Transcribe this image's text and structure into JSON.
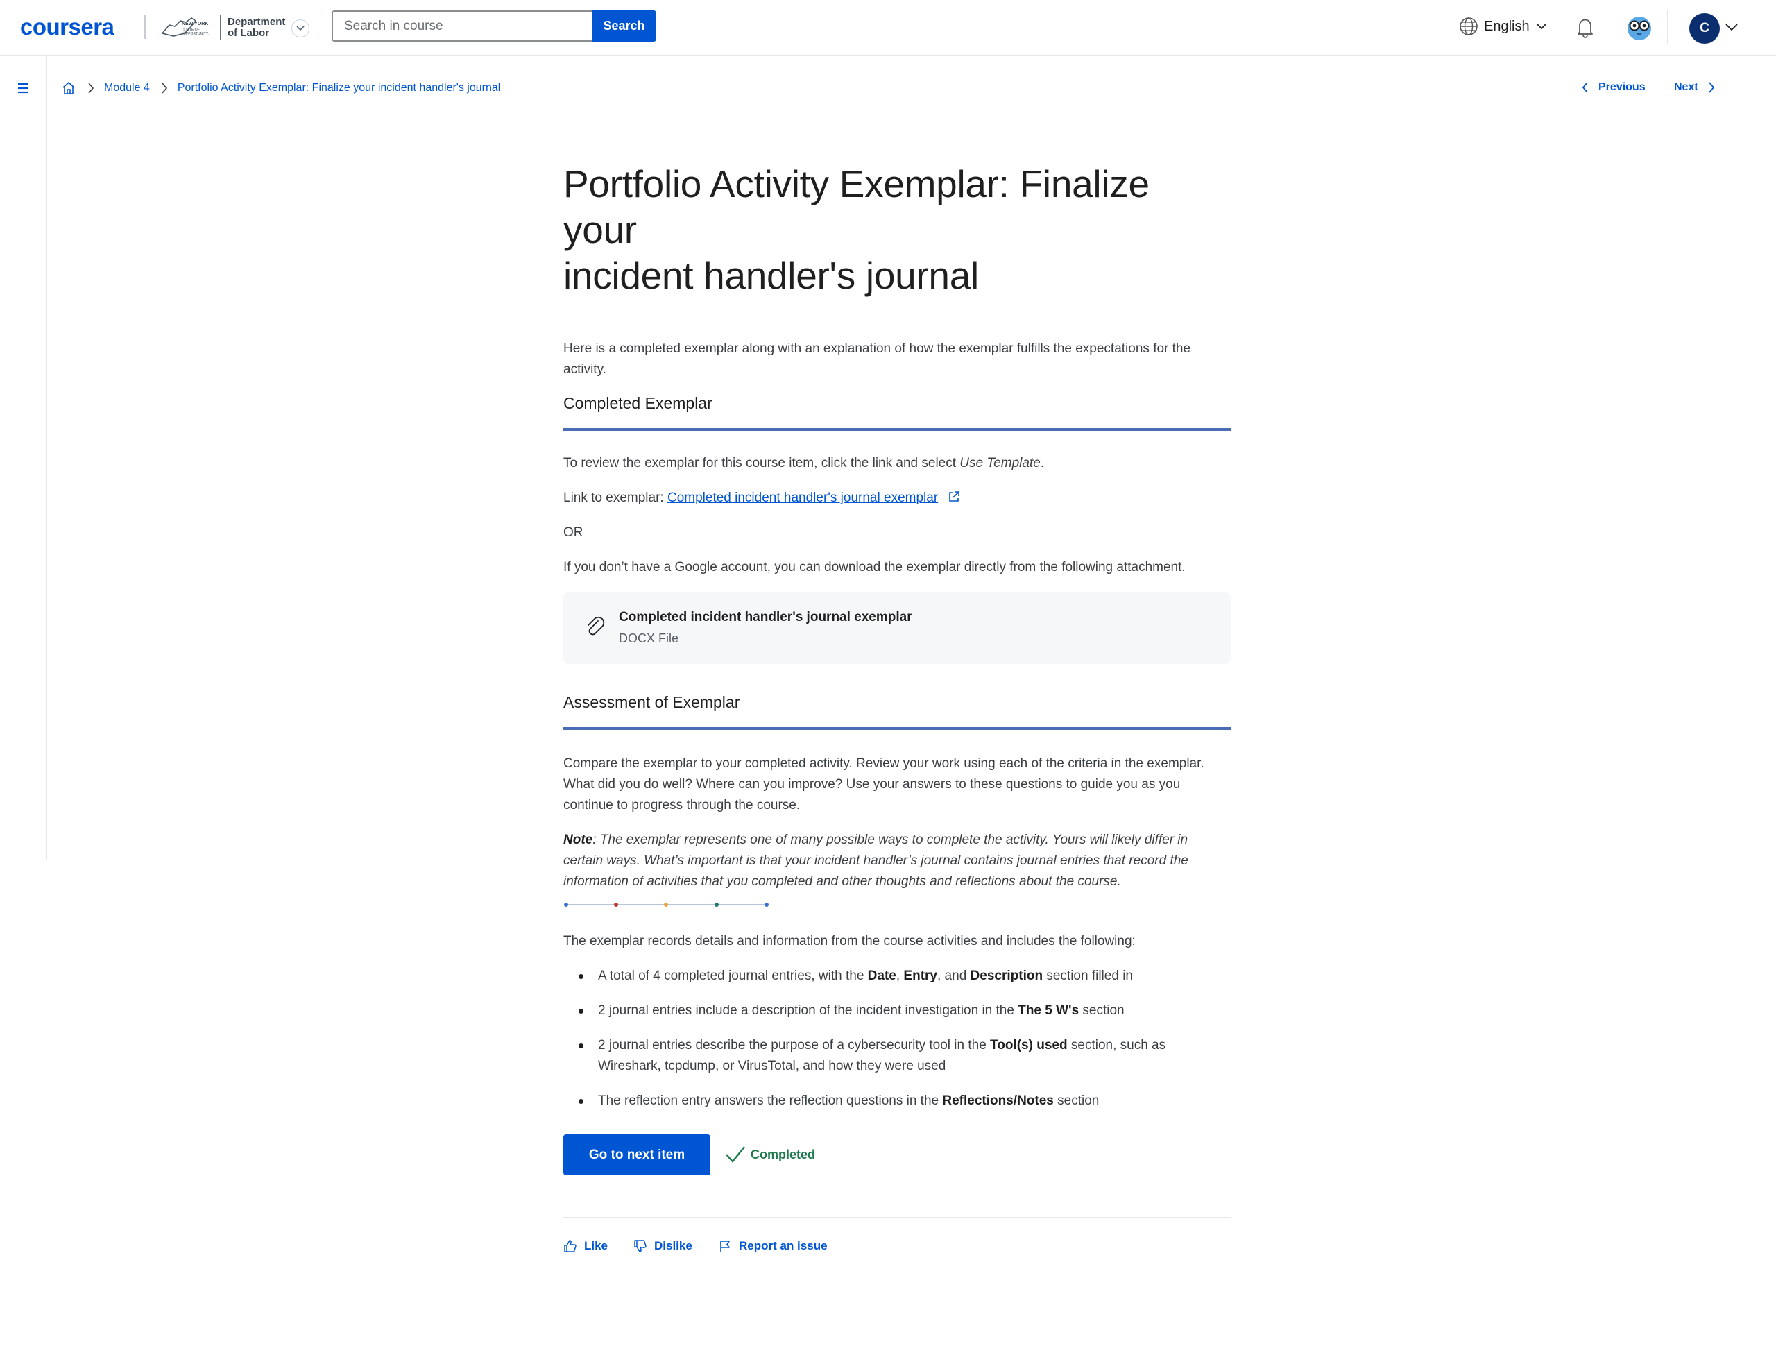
{
  "header": {
    "logo": "coursera",
    "partner_line1": "Department",
    "partner_line2": "of Labor",
    "partner_seal_text": "NEW YORK STATE OF OPPORTUNITY",
    "search_placeholder": "Search in course",
    "search_button": "Search",
    "language": "English",
    "avatar_initial": "C"
  },
  "breadcrumb": {
    "module": "Module 4",
    "current": "Portfolio Activity Exemplar: Finalize your incident handler's journal"
  },
  "nav": {
    "previous": "Previous",
    "next": "Next"
  },
  "content": {
    "title_line1": "Portfolio Activity Exemplar: Finalize your",
    "title_line2": "incident handler's journal",
    "intro": "Here is a completed exemplar along with an explanation of how the exemplar fulfills the expectations for the activity.",
    "section1_heading": "Completed Exemplar",
    "review_text": "To review the exemplar for this course item, click the link and select ",
    "review_emph": "Use Template",
    "review_end": ".",
    "link_label": "Link to exemplar: ",
    "link_text": "Completed incident handler's journal exemplar",
    "or_text": "OR",
    "no_google_text": "If you don’t have a Google account, you can download the exemplar directly from the following attachment.",
    "attachment_name": "Completed incident handler's journal exemplar",
    "attachment_type": "DOCX File",
    "section2_heading": "Assessment of Exemplar",
    "compare_text": "Compare the exemplar to your completed activity. Review your work using each of the criteria in the exemplar. What did you do well? Where can you improve? Use your answers to these questions to guide you as you continue to progress through the course.",
    "note_label": "Note",
    "note_text": ": The exemplar represents one of many possible ways to complete the activity. Yours will likely differ in certain ways. What’s important is that your incident handler’s journal contains journal entries that record the information of activities that you completed and other thoughts and reflections about the course.",
    "records_text": "The exemplar records details and information from the course activities and includes the following:",
    "bullet1_pre": "A total of 4 completed journal entries, with the ",
    "bullet1_b1": "Date",
    "bullet1_c1": ", ",
    "bullet1_b2": "Entry",
    "bullet1_c2": ", and ",
    "bullet1_b3": "Description",
    "bullet1_post": " section filled in",
    "bullet2_pre": "2 journal entries include a description of the incident investigation in the ",
    "bullet2_b": "The 5 W's",
    "bullet2_post": " section",
    "bullet3_pre": "2 journal entries describe the purpose of a cybersecurity tool in the ",
    "bullet3_b": "Tool(s) used",
    "bullet3_post": " section, such as Wireshark, tcpdump, or VirusTotal, and how they were used",
    "bullet4_pre": "The reflection entry answers the reflection questions in the ",
    "bullet4_b": "Reflections/Notes",
    "bullet4_post": " section"
  },
  "actions": {
    "go_next": "Go to next item",
    "status": "Completed",
    "like": "Like",
    "dislike": "Dislike",
    "report": "Report an issue"
  },
  "colors": {
    "brand_blue": "#0056d2",
    "rule_blue": "#4a6cb4",
    "completed_green": "#1e7a4c",
    "divider_dots": [
      "#3b6fd1",
      "#c0392b",
      "#e8a33d",
      "#1e7a6c",
      "#3b6fd1"
    ]
  }
}
